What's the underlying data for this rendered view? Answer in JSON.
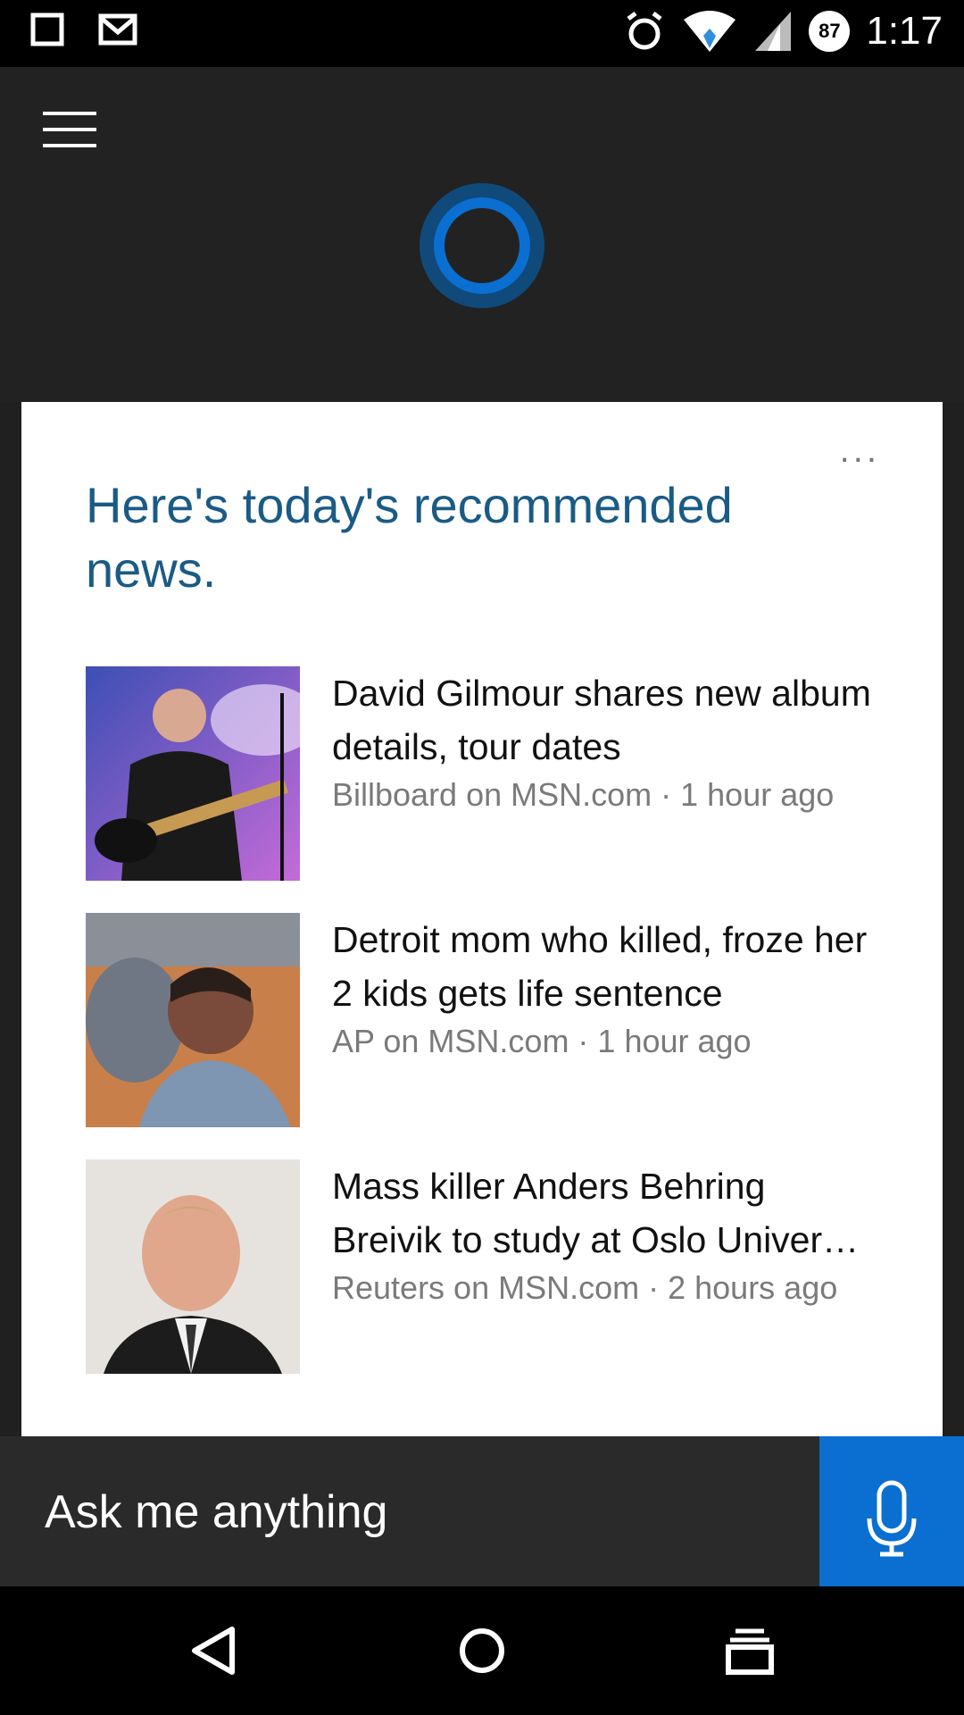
{
  "status_bar": {
    "time": "1:17",
    "battery_level": "87",
    "icons": [
      "square-notification-icon",
      "gmail-icon",
      "alarm-icon",
      "wifi-icon",
      "cell-signal-icon",
      "battery-icon"
    ]
  },
  "header": {
    "menu_icon": "hamburger-menu-icon",
    "logo_icon": "cortana-ring-icon",
    "accent_color": "#0a6fd1"
  },
  "card": {
    "more_label": "...",
    "title": "Here's today's recommended news.",
    "news": [
      {
        "headline": "David Gilmour shares new album details, tour dates",
        "source": "Billboard on MSN.com · 1 hour ago",
        "image": "guitarist-photo"
      },
      {
        "headline": "Detroit mom who killed, froze her 2 kids gets life sentence",
        "source": "AP on MSN.com · 1 hour ago",
        "image": "courtroom-woman-photo"
      },
      {
        "headline": "Mass killer Anders Behring Breivik to study at Oslo Univer…",
        "source": "Reuters on MSN.com · 2 hours ago",
        "image": "man-in-suit-photo"
      }
    ]
  },
  "ask_bar": {
    "placeholder": "Ask me anything",
    "mic_icon": "microphone-icon"
  },
  "nav_bar": {
    "icons": [
      "back-icon",
      "home-icon",
      "recents-icon"
    ]
  }
}
